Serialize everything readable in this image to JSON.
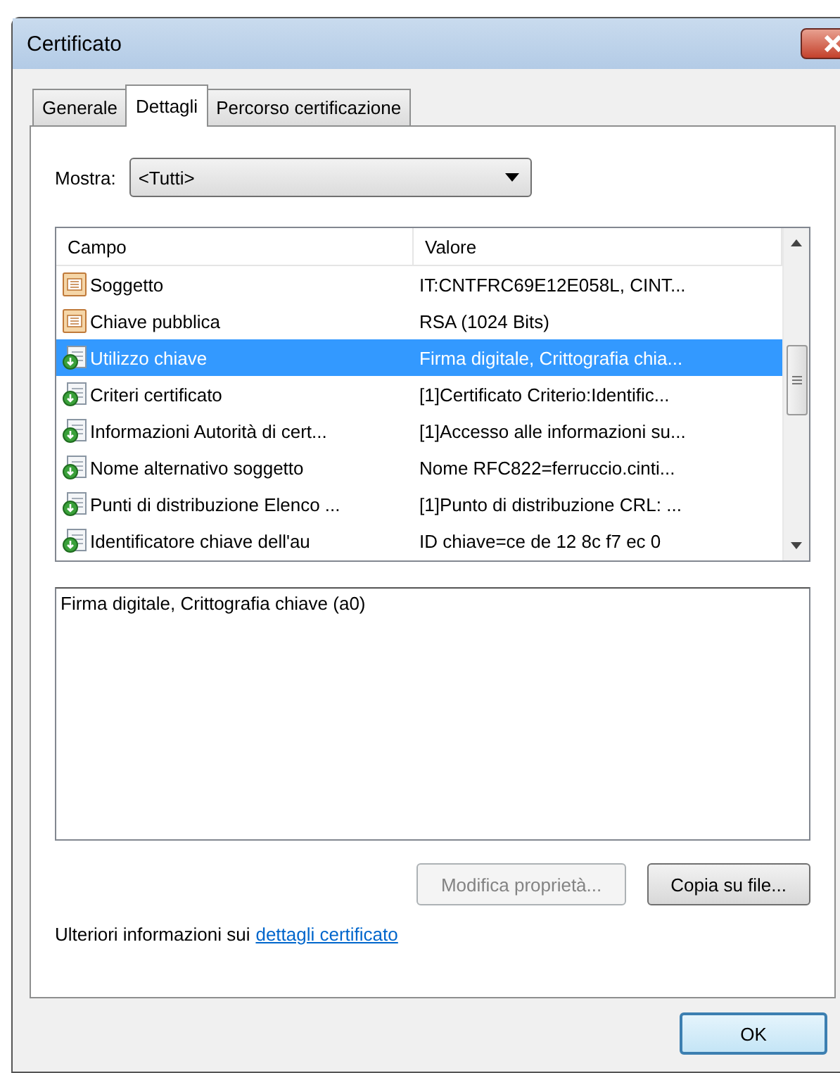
{
  "window": {
    "title": "Certificato"
  },
  "tabs": [
    {
      "label": "Generale",
      "selected": false
    },
    {
      "label": "Dettagli",
      "selected": true
    },
    {
      "label": "Percorso certificazione",
      "selected": false
    }
  ],
  "show": {
    "label": "Mostra:",
    "value": "<Tutti>"
  },
  "table": {
    "columns": [
      "Campo",
      "Valore"
    ],
    "rows": [
      {
        "kind": "document",
        "field": "Soggetto",
        "value": "IT:CNTFRC69E12E058L, CINT...",
        "selected": false
      },
      {
        "kind": "document",
        "field": "Chiave pubblica",
        "value": "RSA (1024 Bits)",
        "selected": false
      },
      {
        "kind": "extension",
        "field": "Utilizzo chiave",
        "value": "Firma digitale, Crittografia chia...",
        "selected": true
      },
      {
        "kind": "extension",
        "field": "Criteri certificato",
        "value": "[1]Certificato Criterio:Identific...",
        "selected": false
      },
      {
        "kind": "extension",
        "field": "Informazioni Autorità di cert...",
        "value": "[1]Accesso alle informazioni su...",
        "selected": false
      },
      {
        "kind": "extension",
        "field": "Nome alternativo soggetto",
        "value": "Nome RFC822=ferruccio.cinti...",
        "selected": false
      },
      {
        "kind": "extension",
        "field": "Punti di distribuzione Elenco ...",
        "value": "[1]Punto di distribuzione CRL: ...",
        "selected": false
      },
      {
        "kind": "extension",
        "field": "Identificatore chiave dell'au",
        "value": "ID chiave=ce de 12 8c f7 ec 0",
        "selected": false
      }
    ]
  },
  "detail": {
    "value": "Firma digitale, Crittografia chiave (a0)"
  },
  "buttons": [
    {
      "label": "Modifica proprietà...",
      "disabled": true
    },
    {
      "label": "Copia su file...",
      "disabled": false
    }
  ],
  "info": {
    "text": "Ulteriori informazioni sui",
    "link": "dettagli certificato"
  },
  "ok": {
    "label": "OK"
  }
}
